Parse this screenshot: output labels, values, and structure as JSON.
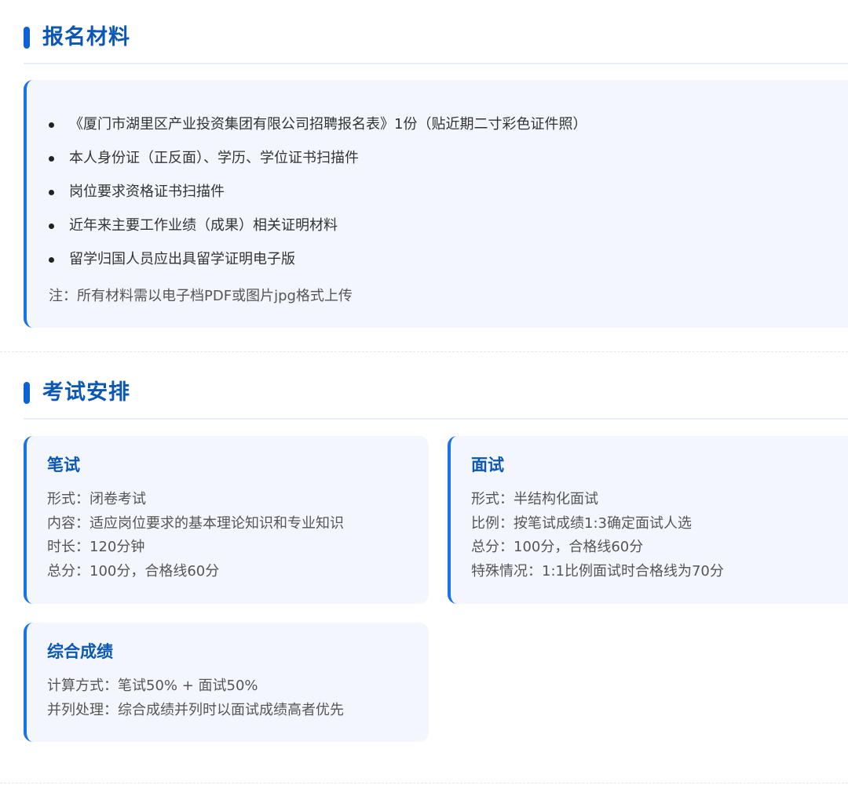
{
  "materials": {
    "title": "报名材料",
    "items": [
      "《厦门市湖里区产业投资集团有限公司招聘报名表》1份（贴近期二寸彩色证件照）",
      "本人身份证（正反面）、学历、学位证书扫描件",
      "岗位要求资格证书扫描件",
      "近年来主要工作业绩（成果）相关证明材料",
      "留学归国人员应出具留学证明电子版"
    ],
    "note": "注：所有材料需以电子档PDF或图片jpg格式上传"
  },
  "exam": {
    "title": "考试安排",
    "written": {
      "title": "笔试",
      "lines": [
        "形式：闭卷考试",
        "内容：适应岗位要求的基本理论知识和专业知识",
        "时长：120分钟",
        "总分：100分，合格线60分"
      ]
    },
    "interview": {
      "title": "面试",
      "lines": [
        "形式：半结构化面试",
        "比例：按笔试成绩1:3确定面试人选",
        "总分：100分，合格线60分",
        "特殊情况：1:1比例面试时合格线为70分"
      ]
    },
    "overall": {
      "title": "综合成绩",
      "lines": [
        "计算方式：笔试50% + 面试50%",
        "并列处理：综合成绩并列时以面试成绩高者优先"
      ]
    }
  },
  "colors": {
    "accent": "#1a73e8",
    "title": "#0b57b5",
    "card_bg": "#f3f7fd"
  }
}
